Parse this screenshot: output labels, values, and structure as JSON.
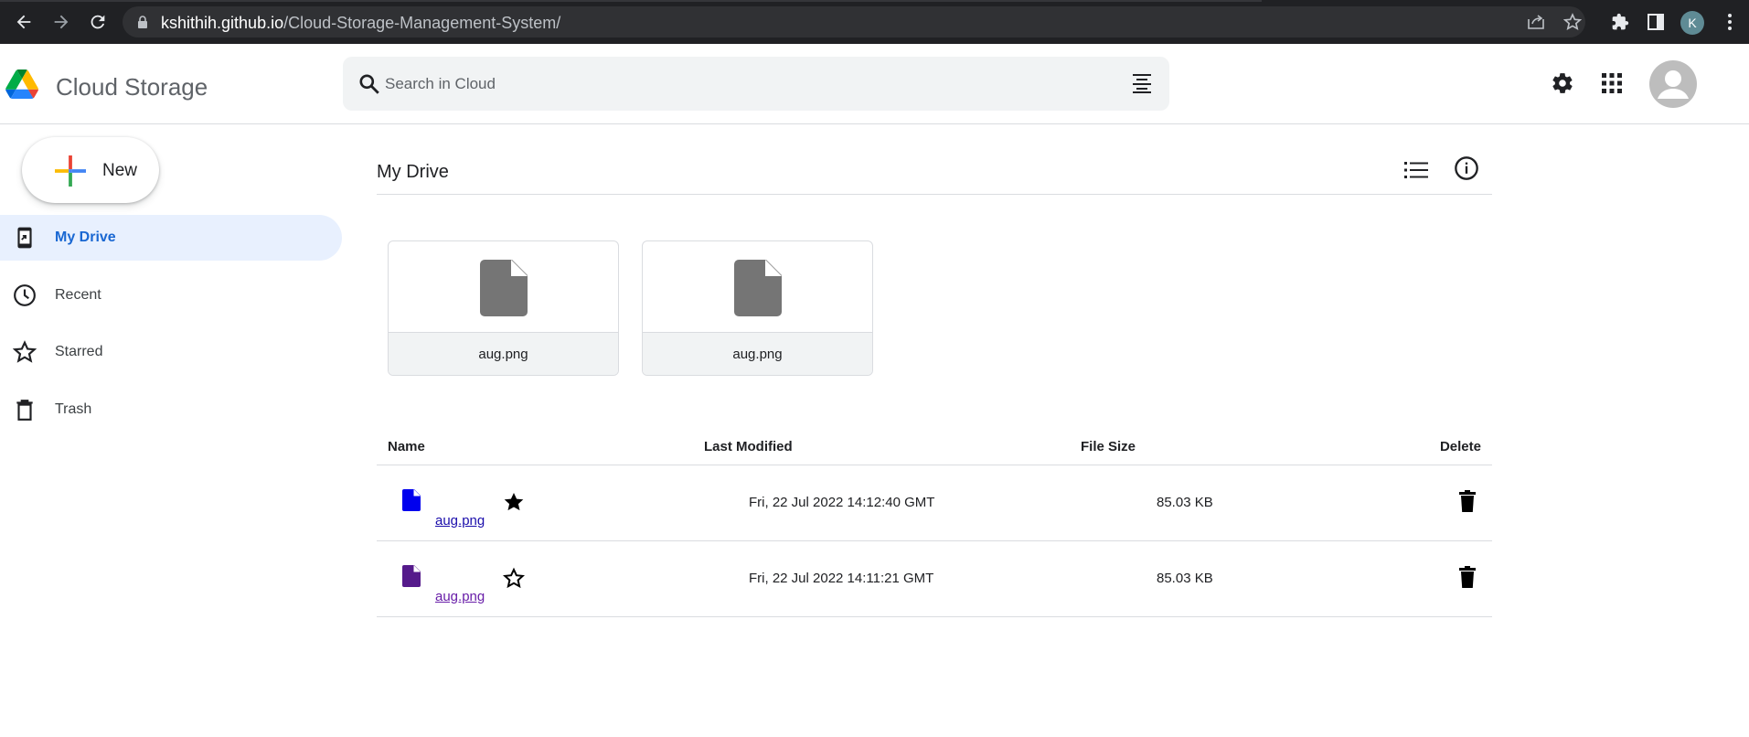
{
  "browser": {
    "url_host": "kshithih.github.io",
    "url_path": "/Cloud-Storage-Management-System/",
    "profile_initial": "K",
    "icons": [
      "back-icon",
      "forward-icon",
      "reload-icon",
      "lock-icon",
      "share-icon",
      "bookmark-star-icon",
      "extensions-icon",
      "side-panel-icon",
      "menu-icon"
    ]
  },
  "header": {
    "title": "Cloud Storage",
    "search_placeholder": "Search in Cloud",
    "icons": [
      "drive-logo-icon",
      "search-icon",
      "search-options-icon",
      "settings-gear-icon",
      "apps-grid-icon",
      "account-avatar-icon"
    ]
  },
  "sidebar": {
    "new_label": "New",
    "items": [
      {
        "label": "My Drive",
        "icon": "my-drive-icon",
        "active": true
      },
      {
        "label": "Recent",
        "icon": "clock-icon",
        "active": false
      },
      {
        "label": "Starred",
        "icon": "star-outline-icon",
        "active": false
      },
      {
        "label": "Trash",
        "icon": "trash-icon",
        "active": false
      }
    ]
  },
  "main": {
    "title": "My Drive",
    "icons": [
      "list-view-icon",
      "info-icon"
    ],
    "quick_access": [
      {
        "name": "aug.png"
      },
      {
        "name": "aug.png"
      }
    ],
    "table": {
      "headers": {
        "name": "Name",
        "modified": "Last Modified",
        "size": "File Size",
        "delete": "Delete"
      },
      "rows": [
        {
          "name": "aug.png",
          "modified": "Fri, 22 Jul 2022 14:12:40 GMT",
          "size": "85.03 KB",
          "starred": true,
          "icon_color": "#0000ee",
          "link_state": "unvisited"
        },
        {
          "name": "aug.png",
          "modified": "Fri, 22 Jul 2022 14:11:21 GMT",
          "size": "85.03 KB",
          "starred": false,
          "icon_color": "#551a8b",
          "link_state": "visited"
        }
      ]
    }
  },
  "colors": {
    "chrome_bg": "#202124",
    "active_nav_bg": "#e8f0fe",
    "active_nav_text": "#1967d2",
    "file_thumb_grey": "#757575"
  }
}
